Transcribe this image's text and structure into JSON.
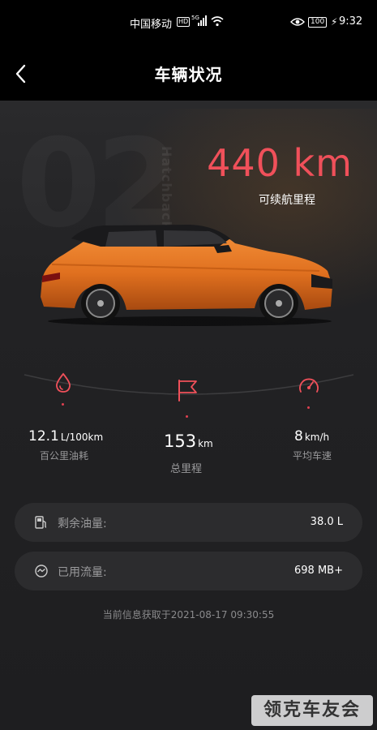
{
  "status_bar": {
    "carrier": "中国移动",
    "hd": "HD",
    "signal": "5G",
    "battery": "100",
    "time": "9:32"
  },
  "header": {
    "title": "车辆状况"
  },
  "hero": {
    "model_number": "02",
    "model_word": "Hatchback",
    "range_value": "440 km",
    "range_label": "可续航里程"
  },
  "stats": {
    "fuel": {
      "value": "12.1",
      "unit": "L/100km",
      "label": "百公里油耗",
      "icon": "fuel-drop-icon"
    },
    "mileage": {
      "value": "153",
      "unit": "km",
      "label": "总里程",
      "icon": "flag-icon"
    },
    "speed": {
      "value": "8",
      "unit": "km/h",
      "label": "平均车速",
      "icon": "speedometer-icon"
    }
  },
  "cards": {
    "fuel_remaining": {
      "label": "剩余油量:",
      "value": "38.0 L",
      "icon": "fuel-pump-icon"
    },
    "data_used": {
      "label": "已用流量:",
      "value": "698 MB+",
      "icon": "data-usage-icon"
    }
  },
  "timestamp": "当前信息获取于2021-08-17 09:30:55",
  "watermark": "领克车友会",
  "colors": {
    "accent": "#f0505a",
    "background": "#222224",
    "card": "#2c2c2e",
    "car_body": "#e8782a"
  }
}
